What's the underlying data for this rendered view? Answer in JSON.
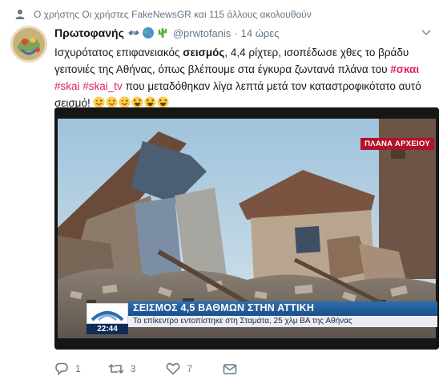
{
  "social_context": {
    "text": "Ο χρήστης Οι χρήστες FakeNewsGR και 115 άλλους ακολουθούν",
    "icon": "person-icon"
  },
  "tweet": {
    "author_name": "Πρωτοφανής",
    "author_handle": "@prwtofanis",
    "separator": "·",
    "time": "14 ώρες",
    "emojis_after_name": [
      "satellite-icon",
      "globe-icon",
      "cactus-icon"
    ],
    "text": {
      "line1_a": "Ισχυρότατος επιφανειακός ",
      "line1_bold": "σεισμός",
      "line1_b": ", 4,4 ρίχτερ, ισοπέδωσε χθες το βράδυ",
      "line2_a": "γειτονιές της Αθήνας, όπως βλέπουμε στα έγκυρα ζωντανά πλάνα του ",
      "line2_hashtag": "#σκαι",
      "line3_hashtag1": "#skai",
      "line3_hashtag2": "#skai_tv",
      "line3_b": " που μεταδόθηκαν λίγα λεπτά μετά τον καταστροφικότατο αυτό",
      "line4_a": "σεισμό!",
      "line4_emojis": [
        "tongue-wink-icon",
        "tongue-wink-icon",
        "tongue-wink-icon",
        "laughing-icon",
        "laughing-icon",
        "laughing-icon"
      ]
    }
  },
  "media": {
    "archive_label": "ΠΛΑΝΑ ΑΡΧΕΙΟΥ",
    "ticker_headline": "ΣΕΙΣΜΟΣ 4,5 ΒΑΘΜΩΝ ΣΤΗΝ ΑΤΤΙΚΗ",
    "ticker_subline": "Το επίκεντρο εντοπίστηκε στη Σταμάτα, 25 χλμ ΒΑ της Αθήνας",
    "ticker_time": "22:44"
  },
  "actions": {
    "reply_count": "1",
    "retweet_count": "3",
    "like_count": "7"
  },
  "colors": {
    "hashtag": "#e0245e",
    "meta_gray": "#657786",
    "ticker_blue": "#1c4f8a",
    "archive_red": "#b0132a"
  }
}
